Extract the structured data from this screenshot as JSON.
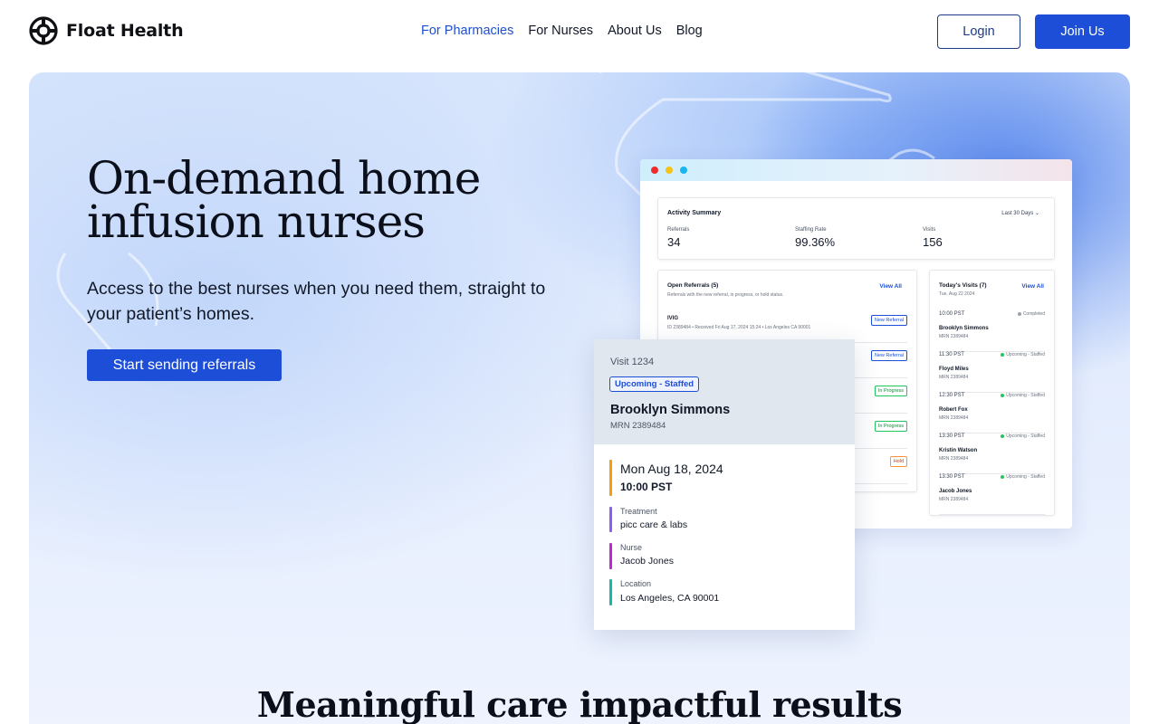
{
  "brand": {
    "name": "Float Health"
  },
  "nav": {
    "items": [
      {
        "label": "For Pharmacies",
        "active": true
      },
      {
        "label": "For Nurses"
      },
      {
        "label": "About Us"
      },
      {
        "label": "Blog"
      }
    ],
    "login_label": "Login",
    "join_label": "Join Us"
  },
  "hero": {
    "title_line1": "On-demand home",
    "title_line2": "infusion nurses",
    "subtitle": "Access to the best nurses when you need them, straight to your patient’s homes.",
    "cta_label": "Start sending referrals"
  },
  "dashboard": {
    "activity": {
      "title": "Activity Summary",
      "range": "Last 30 Days",
      "stats": [
        {
          "label": "Referrals",
          "value": "34"
        },
        {
          "label": "Staffing Rate",
          "value": "99.36%"
        },
        {
          "label": "Visits",
          "value": "156"
        }
      ]
    },
    "referrals": {
      "title": "Open Referrals (5)",
      "view_all": "View All",
      "description": "Referrals with the new referral, in progress, or hold status.",
      "first": {
        "name": "IVIG",
        "meta": "ID 2389484  •  Received Fri Aug 17, 2024 15:24  •  Los Angeles CA 90001"
      },
      "badges": [
        "New Referral",
        "New Referral",
        "In Progress",
        "In Progress",
        "Hold"
      ]
    },
    "visits": {
      "title": "Today's Visits (7)",
      "date": "Tue, Aug 22 2024",
      "view_all": "View All",
      "rows": [
        {
          "time": "10:00 PST",
          "status": "Completed",
          "name": "Brooklyn Simmons",
          "mrn": "MRN 2389484"
        },
        {
          "time": "11:30 PST",
          "status": "Upcoming - Staffed",
          "name": "Floyd Miles",
          "mrn": "MRN 2389484"
        },
        {
          "time": "12:30 PST",
          "status": "Upcoming - Staffed",
          "name": "Robert Fox",
          "mrn": "MRN 2389484"
        },
        {
          "time": "13:30 PST",
          "status": "Upcoming - Staffed",
          "name": "Kristin Watson",
          "mrn": "MRN 2389484"
        },
        {
          "time": "13:30 PST",
          "status": "Upcoming - Staffed",
          "name": "Jacob Jones",
          "mrn": "MRN 2389484"
        }
      ]
    }
  },
  "visit_card": {
    "visit_number": "Visit 1234",
    "badge": "Upcoming - Staffed",
    "patient_name": "Brooklyn Simmons",
    "mrn": "MRN 2389484",
    "date": "Mon Aug 18, 2024",
    "time": "10:00 PST",
    "treatment_label": "Treatment",
    "treatment_value": "picc care & labs",
    "nurse_label": "Nurse",
    "nurse_value": "Jacob Jones",
    "location_label": "Location",
    "location_value": "Los Angeles, CA 90001"
  },
  "section": {
    "title": "Meaningful care impactful results"
  },
  "colors": {
    "accent": "#1d4ed8",
    "date_bar": "#f59e0b",
    "treatment_bar": "#8b5cf6",
    "nurse_bar": "#c026d3",
    "location_bar": "#14b8a6"
  }
}
